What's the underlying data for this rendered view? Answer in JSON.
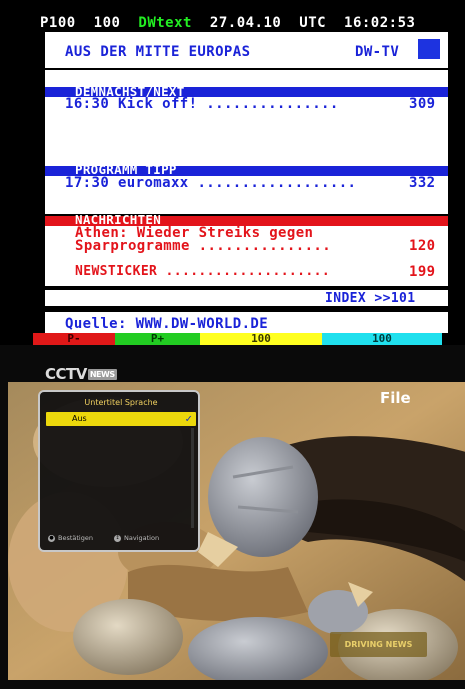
{
  "teletext": {
    "header": {
      "page": "P100",
      "subpage": "100",
      "service": "DWtext",
      "date": "27.04.10",
      "timezone": "UTC",
      "time": "16:02:53"
    },
    "banner": {
      "title": "AUS DER MITTE EUROPAS",
      "channel": "DW-TV"
    },
    "sections": {
      "next": {
        "heading": "DEMNACHST/NEXT",
        "entry": "16:30 Kick off!",
        "dots": "...............",
        "page": "309"
      },
      "tip": {
        "heading": "PROGRAMM TIPP",
        "entry": "17:30 euromaxx",
        "dots": "..................",
        "page": "332"
      },
      "news": {
        "heading": "NACHRICHTEN",
        "line1": "Athen: Wieder Streiks gegen",
        "line2": "Sparprogramme",
        "line2_dots": "...............",
        "line2_page": "120",
        "ticker": "NEWSTICKER",
        "ticker_dots": "....................",
        "ticker_page": "199"
      }
    },
    "index": {
      "label": "INDEX",
      "link": ">>101"
    },
    "source": "Quelle: WWW.DW-WORLD.DE",
    "fastext": [
      {
        "label": "P-",
        "color": "#e01818"
      },
      {
        "label": "P+",
        "color": "#22cc22"
      },
      {
        "label": "100",
        "color": "#ffff20"
      },
      {
        "label": "100",
        "color": "#20e0ee"
      }
    ]
  },
  "tv": {
    "channel_logo": "CCTV",
    "channel_logo_badge": "NEWS",
    "file_label": "File",
    "corner_logo": "DRIVING NEWS",
    "subtitle_menu": {
      "title": "Untertitel Sprache",
      "selected": "Aus",
      "confirm": "Bestätigen",
      "navigate": "Navigation"
    }
  }
}
